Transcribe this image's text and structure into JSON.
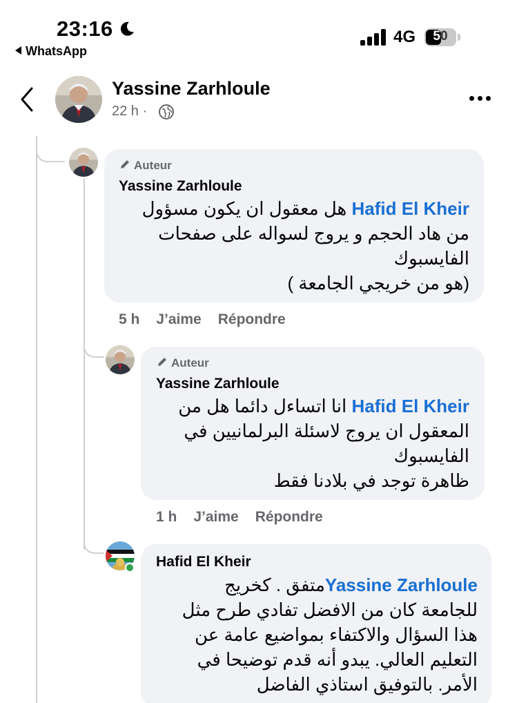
{
  "status_bar": {
    "time": "23:16",
    "back_app": "WhatsApp",
    "network": "4G",
    "battery": "50"
  },
  "post": {
    "author": "Yassine Zarhloule",
    "time_ago": "22 h ·"
  },
  "comments": [
    {
      "badge": "Auteur",
      "name": "Yassine Zarhloule",
      "mention": "Hafid El Kheir",
      "lines": [
        "هل معقول ان يكون مسؤول",
        "من هاد الحجم و يروج لسواله على صفحات",
        "الفايسبوك",
        "(هو من خريجي الجامعة )"
      ],
      "time": "5 h",
      "like": "J’aime",
      "reply": "Répondre"
    },
    {
      "badge": "Auteur",
      "name": "Yassine Zarhloule",
      "mention": "Hafid El Kheir",
      "lines": [
        "انا اتساءل دائما هل من",
        "المعقول ان يروج لاسئلة البرلمانيين في",
        "الفايسبوك",
        "ظاهرة توجد في بلادنا فقط"
      ],
      "time": "1 h",
      "like": "J’aime",
      "reply": "Répondre"
    },
    {
      "name": "Hafid El Kheir",
      "mention": "Yassine Zarhloule",
      "lines": [
        "متفق . كخريج",
        "للجامعة كان من الافضل تفادي طرح مثل",
        "هذا السؤال والاكتفاء بمواضيع عامة عن",
        "التعليم العالي.  يبدو أنه قدم توضيحا في",
        "الأمر. بالتوفيق استاذي الفاضل"
      ]
    }
  ],
  "colors": {
    "mention": "#1a6fd4",
    "bubble": "#f0f2f5",
    "muted": "#65676b",
    "online": "#31a24c"
  },
  "icons": [
    "moon-icon",
    "signal-icon",
    "battery-icon",
    "chevron-left-icon",
    "globe-icon",
    "more-icon",
    "pencil-icon",
    "online-dot"
  ]
}
